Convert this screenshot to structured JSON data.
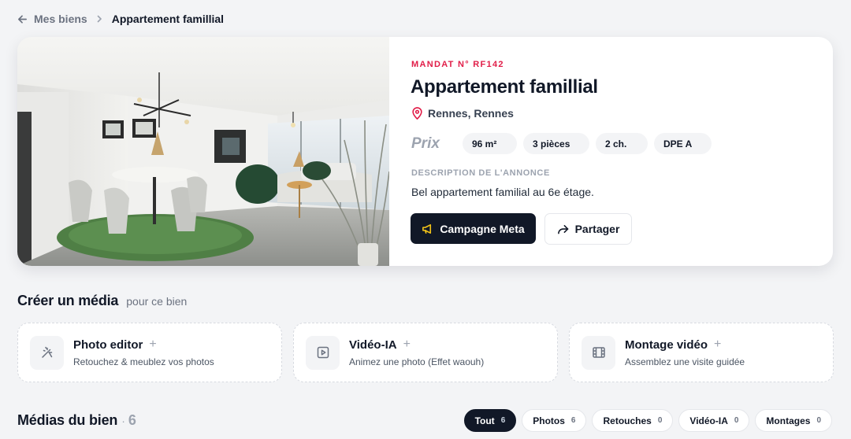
{
  "breadcrumb": {
    "back_label": "Mes biens",
    "current": "Appartement famillial"
  },
  "property": {
    "mandat": "MANDAT N° RF142",
    "title": "Appartement famillial",
    "location": "Rennes, Rennes",
    "price_label": "Prix",
    "chips": [
      "96 m²",
      "3 pièces",
      "2 ch.",
      "DPE A"
    ],
    "description_label": "DESCRIPTION DE L'ANNONCE",
    "description": "Bel appartement familial au 6e étage.",
    "primary_button": "Campagne Meta",
    "secondary_button": "Partager"
  },
  "create_media": {
    "title": "Créer un média",
    "subtitle": "pour ce bien",
    "cards": [
      {
        "icon": "wand-icon",
        "title": "Photo editor",
        "plus": "+",
        "subtitle": "Retouchez & meublez vos photos"
      },
      {
        "icon": "play-icon",
        "title": "Vidéo-IA",
        "plus": "+",
        "subtitle": "Animez une photo (Effet waouh)"
      },
      {
        "icon": "film-icon",
        "title": "Montage vidéo",
        "plus": "+",
        "subtitle": "Assemblez une visite guidée"
      }
    ]
  },
  "medias": {
    "title": "Médias du bien",
    "separator": "·",
    "count": "6",
    "filters": [
      {
        "label": "Tout",
        "count": "6",
        "active": true
      },
      {
        "label": "Photos",
        "count": "6"
      },
      {
        "label": "Retouches",
        "count": "0"
      },
      {
        "label": "Vidéo-IA",
        "count": "0"
      },
      {
        "label": "Montages",
        "count": "0"
      }
    ]
  },
  "colors": {
    "accent_red": "#e11d48",
    "dark": "#111827",
    "background": "#f3f4f6"
  }
}
